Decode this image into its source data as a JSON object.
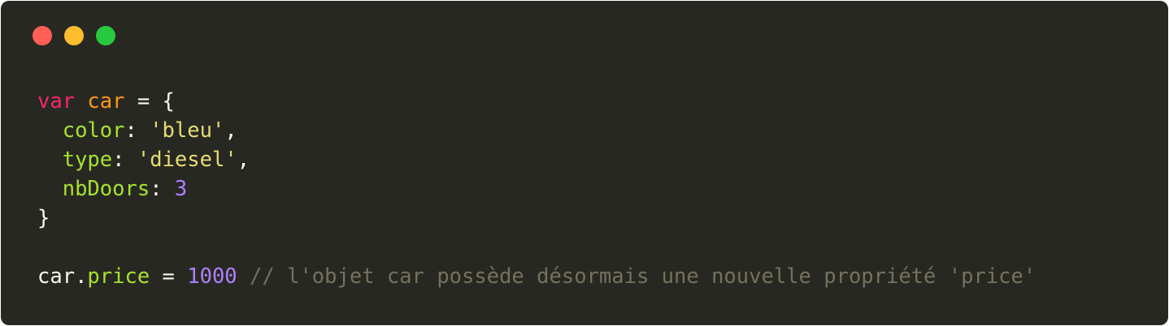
{
  "window_controls": {
    "close_color": "#ff5f56",
    "minimize_color": "#ffbd2e",
    "zoom_color": "#27c93f"
  },
  "colors": {
    "background": "#282822",
    "default": "#f8f8f2",
    "keyword": "#f92672",
    "variable": "#fd971f",
    "property": "#a6e22e",
    "string": "#e6db74",
    "number": "#ae81ff",
    "comment": "#75715e"
  },
  "code": {
    "lines": [
      [
        {
          "text": "var",
          "type": "keyword"
        },
        {
          "text": " ",
          "type": "default"
        },
        {
          "text": "car",
          "type": "variable"
        },
        {
          "text": " = {",
          "type": "default"
        }
      ],
      [
        {
          "text": "  ",
          "type": "default"
        },
        {
          "text": "color",
          "type": "property"
        },
        {
          "text": ": ",
          "type": "default"
        },
        {
          "text": "'bleu'",
          "type": "string"
        },
        {
          "text": ",",
          "type": "default"
        }
      ],
      [
        {
          "text": "  ",
          "type": "default"
        },
        {
          "text": "type",
          "type": "property"
        },
        {
          "text": ": ",
          "type": "default"
        },
        {
          "text": "'diesel'",
          "type": "string"
        },
        {
          "text": ",",
          "type": "default"
        }
      ],
      [
        {
          "text": "  ",
          "type": "default"
        },
        {
          "text": "nbDoors",
          "type": "property"
        },
        {
          "text": ": ",
          "type": "default"
        },
        {
          "text": "3",
          "type": "number"
        }
      ],
      [
        {
          "text": "}",
          "type": "default"
        }
      ],
      [],
      [
        {
          "text": "car",
          "type": "default"
        },
        {
          "text": ".",
          "type": "default"
        },
        {
          "text": "price",
          "type": "property"
        },
        {
          "text": " = ",
          "type": "default"
        },
        {
          "text": "1000",
          "type": "number"
        },
        {
          "text": " ",
          "type": "default"
        },
        {
          "text": "// l'objet car possède désormais une nouvelle propriété 'price'",
          "type": "comment"
        }
      ]
    ]
  }
}
